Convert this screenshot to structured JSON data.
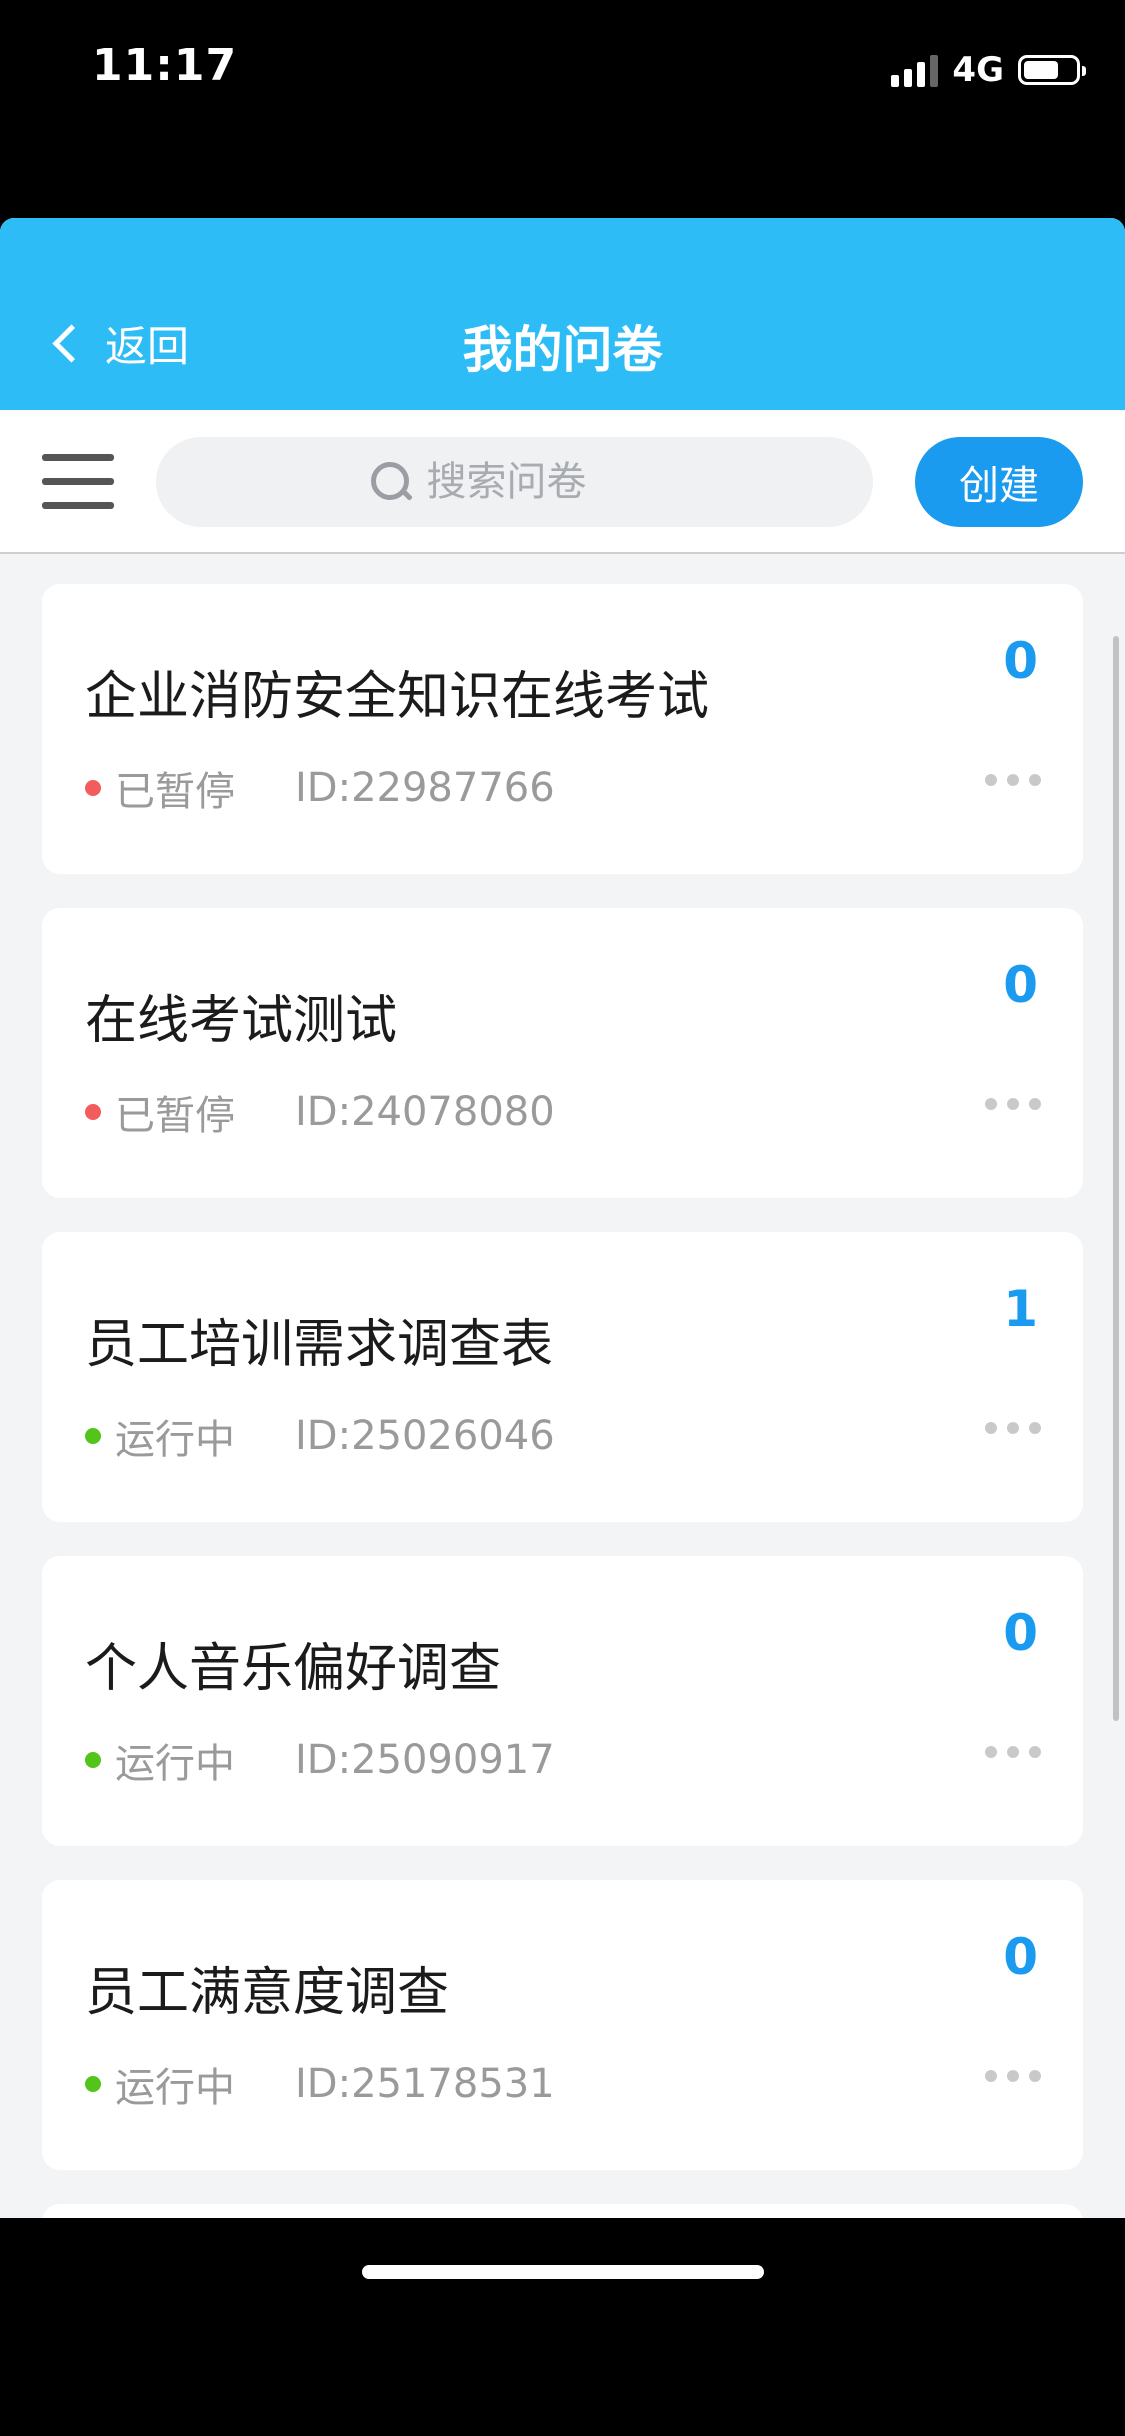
{
  "status_bar": {
    "time": "11:17",
    "network": "4G",
    "battery_level": 0.6
  },
  "nav": {
    "back_label": "返回",
    "title": "我的问卷"
  },
  "toolbar": {
    "search_placeholder": "搜索问卷",
    "create_label": "创建"
  },
  "surveys": [
    {
      "title": "企业消防安全知识在线考试",
      "count": "0",
      "status": "已暂停",
      "status_color": "#f25c5c",
      "id": "ID:22987766"
    },
    {
      "title": "在线考试测试",
      "count": "0",
      "status": "已暂停",
      "status_color": "#f25c5c",
      "id": "ID:24078080"
    },
    {
      "title": "员工培训需求调查表",
      "count": "1",
      "status": "运行中",
      "status_color": "#52c41a",
      "id": "ID:25026046"
    },
    {
      "title": "个人音乐偏好调查",
      "count": "0",
      "status": "运行中",
      "status_color": "#52c41a",
      "id": "ID:25090917"
    },
    {
      "title": "员工满意度调查",
      "count": "0",
      "status": "运行中",
      "status_color": "#52c41a",
      "id": "ID:25178531"
    }
  ],
  "colors": {
    "nav_background": "#2ebcf6",
    "accent": "#1a9bef"
  }
}
